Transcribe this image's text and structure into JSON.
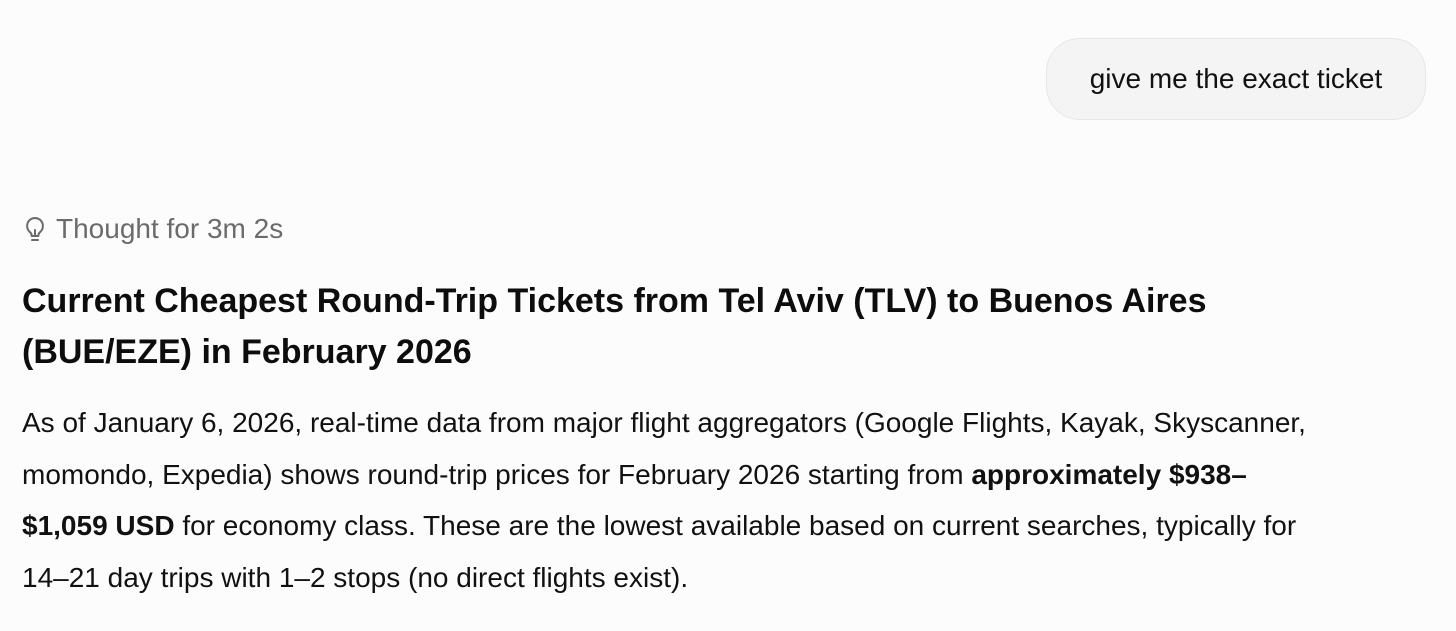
{
  "user_message": {
    "text": "give me the exact ticket"
  },
  "thought": {
    "icon": "lightbulb-icon",
    "label": "Thought for 3m 2s"
  },
  "response": {
    "heading_line1": "Current Cheapest Round-Trip Tickets from Tel Aviv (TLV) to Buenos Aires",
    "heading_line2": "(BUE/EZE) in February 2026",
    "line1": "As of January 6, 2026, real-time data from major flight aggregators (Google Flights, Kayak, Skyscanner,",
    "line2_plain": "momondo, Expedia) shows round-trip prices for February 2026 starting from ",
    "line2_bold": "approximately $938–",
    "line3_bold": "$1,059 USD",
    "line3_plain": " for economy class. These are the lowest available based on current searches, typically for",
    "line4": "14–21 day trips with 1–2 stops (no direct flights exist)."
  }
}
